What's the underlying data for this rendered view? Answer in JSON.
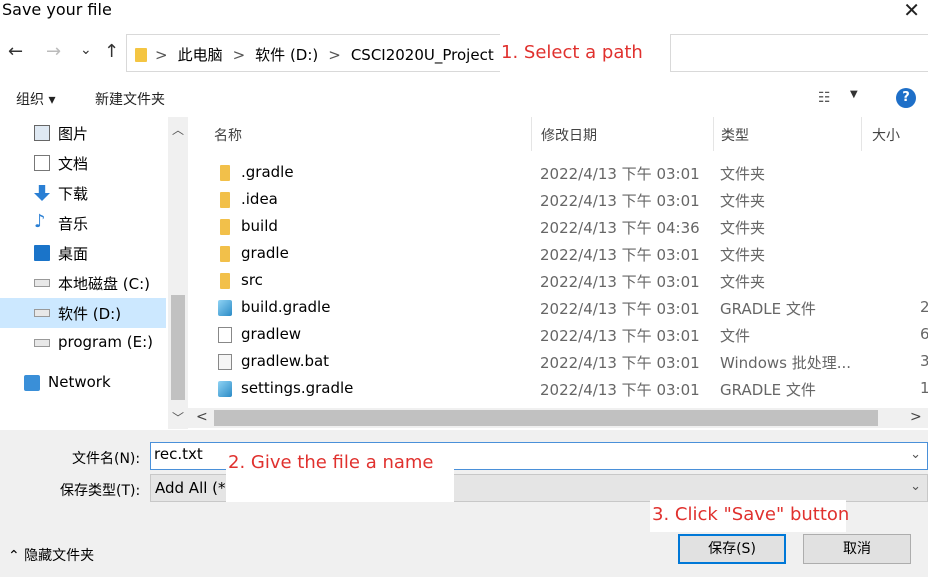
{
  "window": {
    "title": "Save your file",
    "close_glyph": "✕"
  },
  "nav": {
    "back_glyph": "←",
    "forward_glyph": "→",
    "recent_glyph": "⌄",
    "up_glyph": "↑",
    "breadcrumbs": [
      "此电脑",
      "软件 (D:)",
      "CSCI2020U_Project"
    ],
    "crumb_separator": ">"
  },
  "annotations": {
    "step1": "1. Select a path",
    "step2": "2. Give the file a name",
    "step3": "3. Click \"Save\" button"
  },
  "toolbar": {
    "organize_label": "组织 ▾",
    "new_folder_label": "新建文件夹",
    "view_glyph": "☷",
    "view_drop_glyph": "▼",
    "help_label": "?"
  },
  "sidebar": {
    "items": [
      {
        "label": "图片",
        "icon": "pictures-icon"
      },
      {
        "label": "文档",
        "icon": "documents-icon"
      },
      {
        "label": "下载",
        "icon": "download-icon"
      },
      {
        "label": "音乐",
        "icon": "music-icon"
      },
      {
        "label": "桌面",
        "icon": "desktop-icon"
      },
      {
        "label": "本地磁盘 (C:)",
        "icon": "drive-icon"
      },
      {
        "label": "软件 (D:)",
        "icon": "drive-icon",
        "selected": true
      },
      {
        "label": "program (E:)",
        "icon": "drive-icon"
      },
      {
        "label": "Network",
        "icon": "network-icon"
      }
    ],
    "scroll_up": "︿",
    "scroll_down": "﹀"
  },
  "columns": {
    "name": "名称",
    "date": "修改日期",
    "type": "类型",
    "size": "大小",
    "sort_glyph": "^"
  },
  "files": [
    {
      "name": ".gradle",
      "date": "2022/4/13 下午 03:01",
      "type": "文件夹",
      "size": "",
      "kind": "folder"
    },
    {
      "name": ".idea",
      "date": "2022/4/13 下午 03:01",
      "type": "文件夹",
      "size": "",
      "kind": "folder"
    },
    {
      "name": "build",
      "date": "2022/4/13 下午 04:36",
      "type": "文件夹",
      "size": "",
      "kind": "folder"
    },
    {
      "name": "gradle",
      "date": "2022/4/13 下午 03:01",
      "type": "文件夹",
      "size": "",
      "kind": "folder"
    },
    {
      "name": "src",
      "date": "2022/4/13 下午 03:01",
      "type": "文件夹",
      "size": "",
      "kind": "folder"
    },
    {
      "name": "build.gradle",
      "date": "2022/4/13 下午 03:01",
      "type": "GRADLE 文件",
      "size": "2",
      "kind": "gradle"
    },
    {
      "name": "gradlew",
      "date": "2022/4/13 下午 03:01",
      "type": "文件",
      "size": "6",
      "kind": "blank"
    },
    {
      "name": "gradlew.bat",
      "date": "2022/4/13 下午 03:01",
      "type": "Windows 批处理...",
      "size": "3",
      "kind": "bat"
    },
    {
      "name": "settings.gradle",
      "date": "2022/4/13 下午 03:01",
      "type": "GRADLE 文件",
      "size": "1",
      "kind": "gradle"
    }
  ],
  "hscroll": {
    "left_glyph": "<",
    "right_glyph": ">"
  },
  "form": {
    "filename_label": "文件名(N):",
    "filename_value": "rec.txt",
    "filetype_label": "保存类型(T):",
    "filetype_value": "Add All (*)",
    "dropdown_glyph": "⌄"
  },
  "footer": {
    "hide_folders_label": "⌃ 隐藏文件夹",
    "save_label": "保存(S)",
    "cancel_label": "取消"
  }
}
